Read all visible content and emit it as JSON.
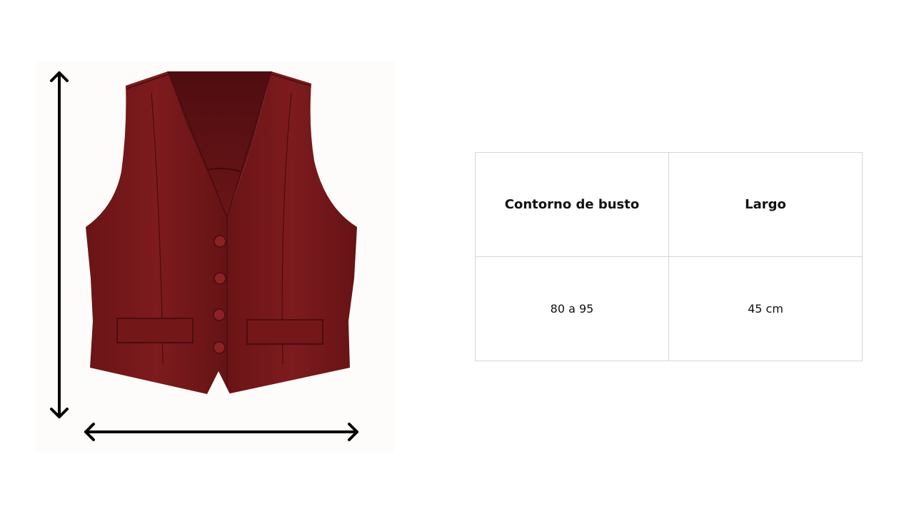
{
  "image": {
    "subject": "burgundy-vest",
    "garment_color": "#7a1a1c",
    "arrow_color": "#000000"
  },
  "size_table": {
    "headers": [
      "Contorno de busto",
      "Largo"
    ],
    "rows": [
      [
        "80 a 95",
        "45 cm"
      ]
    ]
  }
}
